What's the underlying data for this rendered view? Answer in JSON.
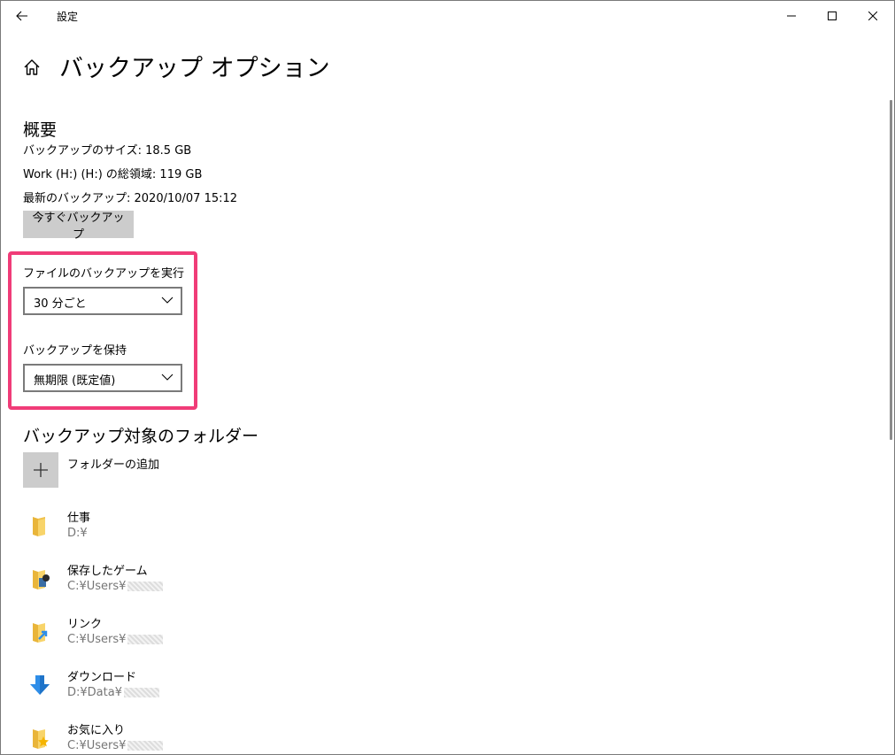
{
  "window": {
    "title": "設定"
  },
  "page": {
    "title": "バックアップ オプション"
  },
  "overview": {
    "heading": "概要",
    "backup_size": "バックアップのサイズ: 18.5 GB",
    "total_space": "Work (H:) (H:) の総領域: 119 GB",
    "latest_backup": "最新のバックアップ: 2020/10/07 15:12",
    "backup_now_label": "今すぐバックアップ"
  },
  "settings": {
    "run_backup_label": "ファイルのバックアップを実行",
    "run_backup_value": "30 分ごと",
    "keep_backup_label": "バックアップを保持",
    "keep_backup_value": "無期限 (既定値)"
  },
  "folders": {
    "heading": "バックアップ対象のフォルダー",
    "add_label": "フォルダーの追加",
    "items": [
      {
        "name": "仕事",
        "path": "D:¥",
        "icon": "folder-icon"
      },
      {
        "name": "保存したゲーム",
        "path": "C:¥Users¥",
        "icon": "saved-games-icon"
      },
      {
        "name": "リンク",
        "path": "C:¥Users¥",
        "icon": "links-folder-icon"
      },
      {
        "name": "ダウンロード",
        "path": "D:¥Data¥",
        "icon": "download-icon"
      },
      {
        "name": "お気に入り",
        "path": "C:¥Users¥",
        "icon": "favorites-folder-icon"
      }
    ]
  },
  "colors": {
    "highlight": "#f03c78",
    "button_bg": "#cccccc",
    "secondary_text": "#767676",
    "folder_yellow": "#f5c84c",
    "download_blue": "#2f8ee8"
  }
}
